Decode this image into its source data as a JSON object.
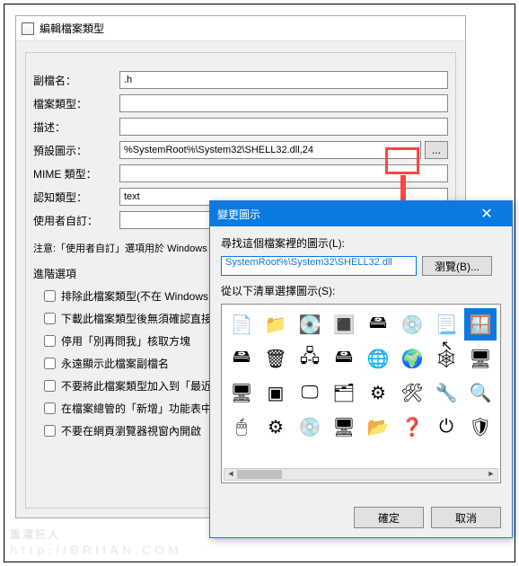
{
  "main": {
    "title": "編輯檔案類型",
    "fields": {
      "ext_label": "副檔名：",
      "ext_value": ".h",
      "type_label": "檔案類型：",
      "type_value": "",
      "desc_label": "描述：",
      "desc_value": "",
      "icon_label": "預設圖示：",
      "icon_value": "%SystemRoot%\\System32\\SHELL32.dll,24",
      "browse_label": "...",
      "mime_label": "MIME 類型：",
      "mime_value": "",
      "perceived_label": "認知類型：",
      "perceived_value": "text",
      "user_label": "使用者自訂："
    },
    "note": "注意:「使用者自訂」選項用於 Windows 預設程式(開啟 -> 選擇預設程式)。當您設動作",
    "adv_label": "進階選項",
    "checks": [
      "排除此檔案類型(不在 Windows 的",
      "下載此檔案類型後無須確認直接開",
      "停用「別再問我」核取方塊",
      "永遠顯示此檔案副檔名",
      "不要將此檔案類型加入到「最近的",
      "在檔案總管的「新增」功能表中顯",
      "不要在網頁瀏覽器視窗內開啟"
    ]
  },
  "dialog": {
    "title": "變更圖示",
    "close_label": "✕",
    "find_label": "尋找這個檔案裡的圖示(L):",
    "path_value": "SystemRoot%\\System32\\SHELL32.dll",
    "browse_label": "瀏覽(B)...",
    "select_label": "從以下清單選擇圖示(S):",
    "ok_label": "確定",
    "cancel_label": "取消",
    "icons": [
      {
        "name": "blank-file-icon",
        "glyph": "📄"
      },
      {
        "name": "folder-icon",
        "glyph": "📁"
      },
      {
        "name": "drive-icon",
        "glyph": "💽"
      },
      {
        "name": "chip-icon",
        "glyph": "🔳"
      },
      {
        "name": "hdd-icon",
        "glyph": "🖴"
      },
      {
        "name": "disc-drive-icon",
        "glyph": "💿"
      },
      {
        "name": "page-icon",
        "glyph": "📃"
      },
      {
        "name": "window-icon",
        "glyph": "🪟",
        "selected": true
      },
      {
        "name": "drive2-icon",
        "glyph": "🖴"
      },
      {
        "name": "trash-icon",
        "glyph": "🗑"
      },
      {
        "name": "network-icon",
        "glyph": "🖧"
      },
      {
        "name": "netdrive-icon",
        "glyph": "🖴"
      },
      {
        "name": "globe-icon",
        "glyph": "🌐"
      },
      {
        "name": "earth-icon",
        "glyph": "🌍"
      },
      {
        "name": "net-icon",
        "glyph": "🕸"
      },
      {
        "name": "computer-icon",
        "glyph": "🖥"
      },
      {
        "name": "monitor-icon",
        "glyph": "🖥"
      },
      {
        "name": "app-icon",
        "glyph": "▣"
      },
      {
        "name": "screen-icon",
        "glyph": "🖵"
      },
      {
        "name": "stack-icon",
        "glyph": "🗂"
      },
      {
        "name": "gears-icon",
        "glyph": "⚙"
      },
      {
        "name": "setup-icon",
        "glyph": "🛠"
      },
      {
        "name": "wrench-icon",
        "glyph": "🔧"
      },
      {
        "name": "search-icon",
        "glyph": "🔍"
      },
      {
        "name": "cursor-icon",
        "glyph": "🖱"
      },
      {
        "name": "gear2-icon",
        "glyph": "⚙"
      },
      {
        "name": "disc-icon",
        "glyph": "💿"
      },
      {
        "name": "device-icon",
        "glyph": "🖥"
      },
      {
        "name": "folder2-icon",
        "glyph": "📂"
      },
      {
        "name": "help-icon",
        "glyph": "❓"
      },
      {
        "name": "power-icon",
        "glyph": "⏻"
      },
      {
        "name": "shield-icon",
        "glyph": "🛡"
      }
    ]
  },
  "watermark": {
    "big": "重灌狂人",
    "small": "http://BRIIAN.COM"
  }
}
